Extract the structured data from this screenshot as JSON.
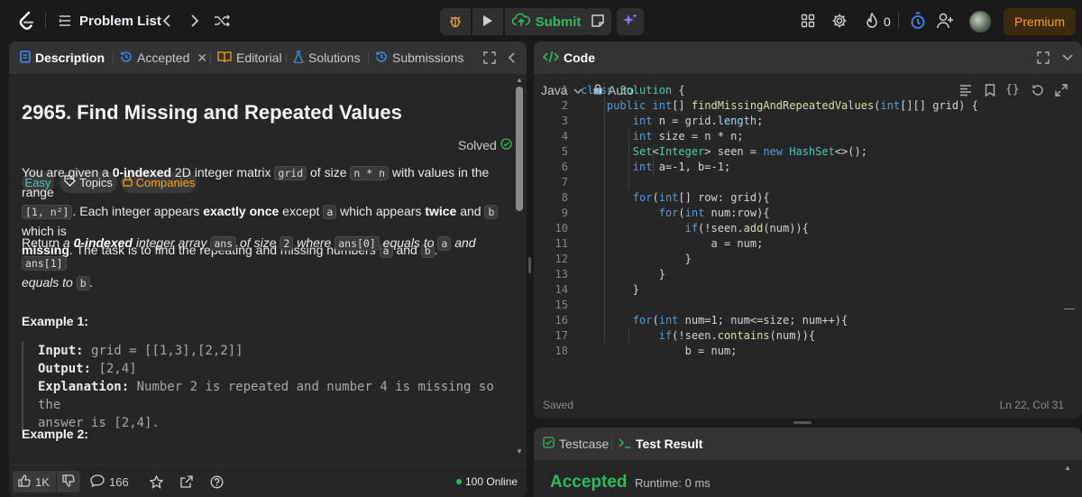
{
  "nav": {
    "problem_list": "Problem List",
    "submit_label": "Submit",
    "streak_count": "0",
    "premium_label": "Premium"
  },
  "description": {
    "tabs": [
      {
        "label": "Description"
      },
      {
        "label": "Accepted"
      },
      {
        "label": "Editorial"
      },
      {
        "label": "Solutions"
      },
      {
        "label": "Submissions"
      }
    ],
    "title": "2965. Find Missing and Repeated Values",
    "status": "Solved",
    "difficulty": "Easy",
    "topics_label": "Topics",
    "companies_label": "Companies",
    "example1_title": "Example 1:",
    "example1_input_label": "Input:",
    "example1_input": "grid = [[1,3],[2,2]]",
    "example1_output_label": "Output:",
    "example1_output": "[2,4]",
    "example1_expl_label": "Explanation:",
    "example1_expl_line1": "Number 2 is repeated and number 4 is missing so the",
    "example1_expl_line2": "answer is [2,4].",
    "example2_title": "Example 2:",
    "likes": "1K",
    "comments": "166",
    "online": "100 Online",
    "p1": {
      "t1": "You are given a ",
      "b1": "0-indexed",
      "t2": " 2D integer matrix ",
      "c1": "grid",
      "t3": " of size ",
      "c2": "n * n",
      "t4": " with values in the range",
      "c3": "[1, n²]",
      "t5": ". Each integer appears ",
      "b2": "exactly once",
      "t6": " except ",
      "c4": "a",
      "t7": " which appears ",
      "b3": "twice",
      "t8": " and ",
      "c5": "b",
      "t9": " which is",
      "b4": "missing",
      "t10": ". The task is to find the repeating and missing numbers ",
      "c6": "a",
      "t11": " and ",
      "c7": "b",
      "t12": "."
    },
    "p2": {
      "t1": "Return ",
      "i1": "a ",
      "bi1": "0-indexed",
      "i2": " integer array ",
      "c1": "ans",
      "i3": " of size ",
      "c2": "2",
      "i4": " where ",
      "c3": "ans[0]",
      "i5": " equals to ",
      "c4": "a",
      "i6": " and ",
      "c5": "ans[1]",
      "i7": "equals to ",
      "c6": "b",
      "i8": "."
    }
  },
  "code": {
    "tab_label": "Code",
    "language": "Java",
    "mode": "Auto",
    "saved": "Saved",
    "cursor": "Ln 22, Col 31",
    "lines": [
      "class Solution {",
      "    public int[] findMissingAndRepeatedValues(int[][] grid) {",
      "        int n = grid.length;",
      "        int size = n * n;",
      "        Set<Integer> seen = new HashSet<>();",
      "        int a=-1, b=-1;",
      "",
      "        for(int[] row: grid){",
      "            for(int num:row){",
      "                if(!seen.add(num)){",
      "                    a = num;",
      "                }",
      "            }",
      "        }",
      "",
      "        for(int num=1; num<=size; num++){",
      "            if(!seen.contains(num)){",
      "                b = num;"
    ]
  },
  "result": {
    "testcase_label": "Testcase",
    "test_result_label": "Test Result",
    "status": "Accepted",
    "runtime": "Runtime: 0 ms"
  },
  "colors": {
    "accent": "#ffa116",
    "success": "#2cbb5d",
    "easy": "#46c6c2",
    "panel": "#262626",
    "header": "#333333"
  }
}
